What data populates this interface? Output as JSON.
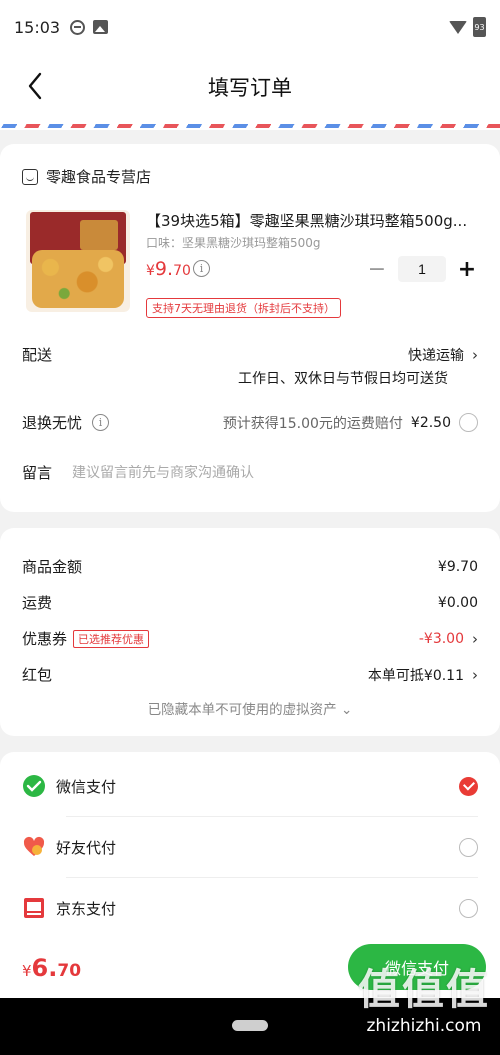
{
  "status_bar": {
    "time": "15:03",
    "battery": "93"
  },
  "nav": {
    "title": "填写订单"
  },
  "shop": {
    "name": "零趣食品专营店"
  },
  "product": {
    "title": "【39块选5箱】零趣坚果黑糖沙琪玛整箱500g...",
    "variant": "口味：坚果黑糖沙琪玛整箱500g",
    "price_currency": "¥",
    "price_int": "9.",
    "price_dec": "70",
    "quantity": "1",
    "minus": "−",
    "plus": "+",
    "return_badge": "支持7天无理由退货（拆封后不支持）"
  },
  "delivery": {
    "label": "配送",
    "method": "快递运输",
    "schedule": "工作日、双休日与节假日均可送货"
  },
  "return_worry": {
    "label": "退换无忧",
    "desc": "预计获得15.00元的运费赔付",
    "price": "¥2.50"
  },
  "note": {
    "label": "留言",
    "placeholder": "建议留言前先与商家沟通确认"
  },
  "summary": {
    "goods_label": "商品金额",
    "goods_value": "¥9.70",
    "shipping_label": "运费",
    "shipping_value": "¥0.00",
    "coupon_label": "优惠券",
    "coupon_tag": "已选推荐优惠",
    "coupon_value": "-¥3.00",
    "redpacket_label": "红包",
    "redpacket_value": "本单可抵¥0.11",
    "hidden_note": "已隐藏本单不可使用的虚拟资产 ⌄"
  },
  "payment": {
    "options": [
      {
        "label": "微信支付",
        "selected": true
      },
      {
        "label": "好友代付",
        "selected": false
      },
      {
        "label": "京东支付",
        "selected": false
      }
    ]
  },
  "bottom": {
    "currency": "¥",
    "total_int": "6.",
    "total_dec": "70",
    "pay_button": "微信支付"
  },
  "watermark": {
    "big": "值值值",
    "small": "zhizhizhi.com"
  },
  "colors": {
    "accent_red": "#e4393c",
    "wechat_green": "#2cb744"
  }
}
